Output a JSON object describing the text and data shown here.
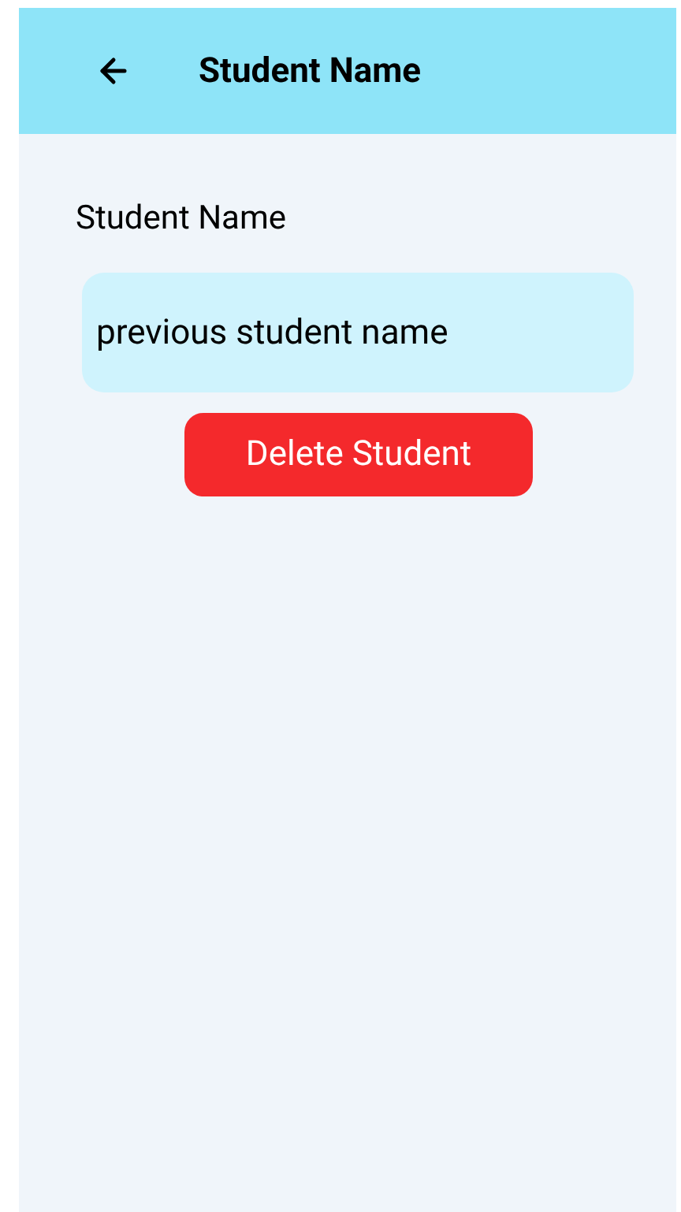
{
  "header": {
    "title": "Student Name"
  },
  "form": {
    "label": "Student Name",
    "name_field": {
      "value": "previous student name"
    },
    "delete_button": "Delete Student"
  }
}
